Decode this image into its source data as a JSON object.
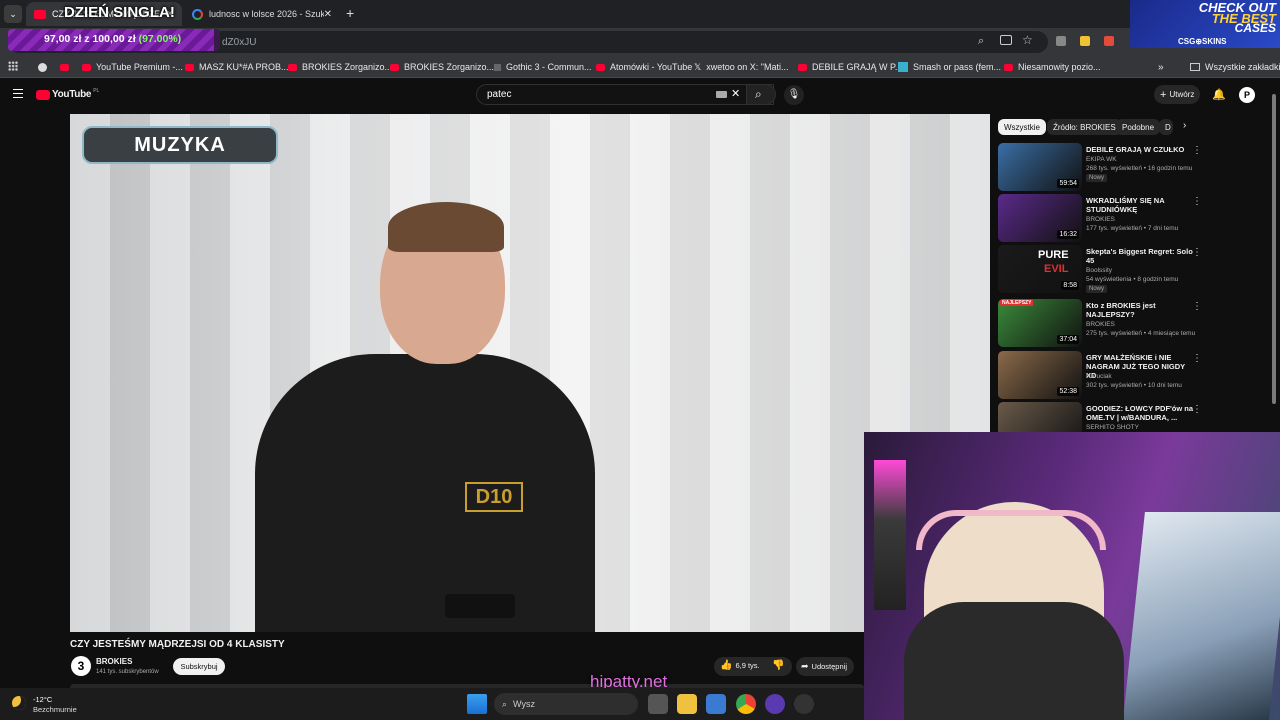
{
  "browser": {
    "tabs": [
      {
        "label": "CZY JESTEŚMY MĄDRZEJSI"
      },
      {
        "label": "ludnosc w lolsce 2026 - Szukaj"
      }
    ],
    "new_tab_label": "+",
    "url": "dZ0xJU",
    "bookmarks": [
      {
        "label": ""
      },
      {
        "label": "YouTube Premium -..."
      },
      {
        "label": "MASZ KU*#A PROB..."
      },
      {
        "label": "BROKIES Zorganizo..."
      },
      {
        "label": "BROKIES Zorganizo..."
      },
      {
        "label": "Gothic 3 - Commun..."
      },
      {
        "label": "Atomówki - YouTube"
      },
      {
        "label": "xwetoo on X: \"Mati..."
      },
      {
        "label": "DEBILE GRAJĄ W P..."
      },
      {
        "label": "Smash or pass (fem..."
      },
      {
        "label": "Niesamowity pozio..."
      }
    ],
    "all_bookmarks_label": "Wszystkie zakładki"
  },
  "overlay": {
    "singla_title": "DZIEŃ SINGLA!",
    "goal_text": "97,00 zł z 100,00 zł",
    "goal_percent_text": "(97.00%)",
    "goal_fraction": 0.97,
    "casebox_line1": "CHECK OUT",
    "casebox_line2": "THE BEST",
    "casebox_line3": "CASES",
    "casebox_brand": "CSG⊕SKINS",
    "site": "hipatty.net"
  },
  "youtube": {
    "logo": "YouTube",
    "logo_region": "PL",
    "search_value": "patec",
    "create_label": "Utwórz",
    "video_overlay_label": "MUZYKA",
    "shirt_text": "D10",
    "video_title": "CZY JESTEŚMY MĄDRZEJSI OD 4 KLASISTY",
    "channel": "BROKIES",
    "channel_avatar": "3",
    "subscribers": "141 tys. subskrybentów",
    "subscribe_label": "Subskrybuj",
    "likes": "6,9 tys.",
    "share_label": "Udostępnij",
    "filter_chips": [
      "Wszystkie",
      "Źródło: BROKIES",
      "Podobne",
      "D"
    ],
    "recommendations": [
      {
        "title": "DEBILE GRAJĄ W CZUŁKO",
        "channel": "EKIPA WK",
        "meta": "268 tys. wyświetleń • 16 godzin temu",
        "badge": "Nowy",
        "duration": "59:54",
        "color": "#3a6ea5"
      },
      {
        "title": "WKRADLIŚMY SIĘ NA STUDNIÓWKĘ",
        "channel": "BROKIES",
        "meta": "177 tys. wyświetleń • 7 dni temu",
        "badge": "",
        "duration": "16:32",
        "color": "#5a2a8a"
      },
      {
        "title": "Skepta's Biggest Regret: Solo 45",
        "channel": "Boolssity",
        "meta": "54 wyświetlenia • 8 godzin temu",
        "badge": "Nowy",
        "duration": "8:58",
        "color": "#1a1a1a",
        "thumb_text1": "PURE",
        "thumb_text2": "EVIL"
      },
      {
        "title": "Kto z BROKIES jest NAJLEPSZY?",
        "channel": "BROKIES",
        "meta": "275 tys. wyświetleń • 4 miesiące temu",
        "badge": "",
        "duration": "37:04",
        "color": "#3a8a3a",
        "thumb_tag": "NAJLEPSZY"
      },
      {
        "title": "GRY MAŁŻEŃSKIE i NIE NAGRAM JUŻ TEGO NIGDY XD",
        "channel": "Naruciak",
        "meta": "302 tys. wyświetleń • 10 dni temu",
        "badge": "",
        "duration": "52:38",
        "color": "#8a6a4a"
      },
      {
        "title": "GOODIEZ: ŁOWCY PDF'ów na OME.TV | w/BANDURA, ...",
        "channel": "SERHITO SHOTY",
        "meta": "",
        "badge": "",
        "duration": "",
        "color": "#6a5a4a"
      }
    ]
  },
  "taskbar": {
    "weather_temp": "-12°C",
    "weather_desc": "Bezchmurnie",
    "search_placeholder": "Wysz"
  }
}
